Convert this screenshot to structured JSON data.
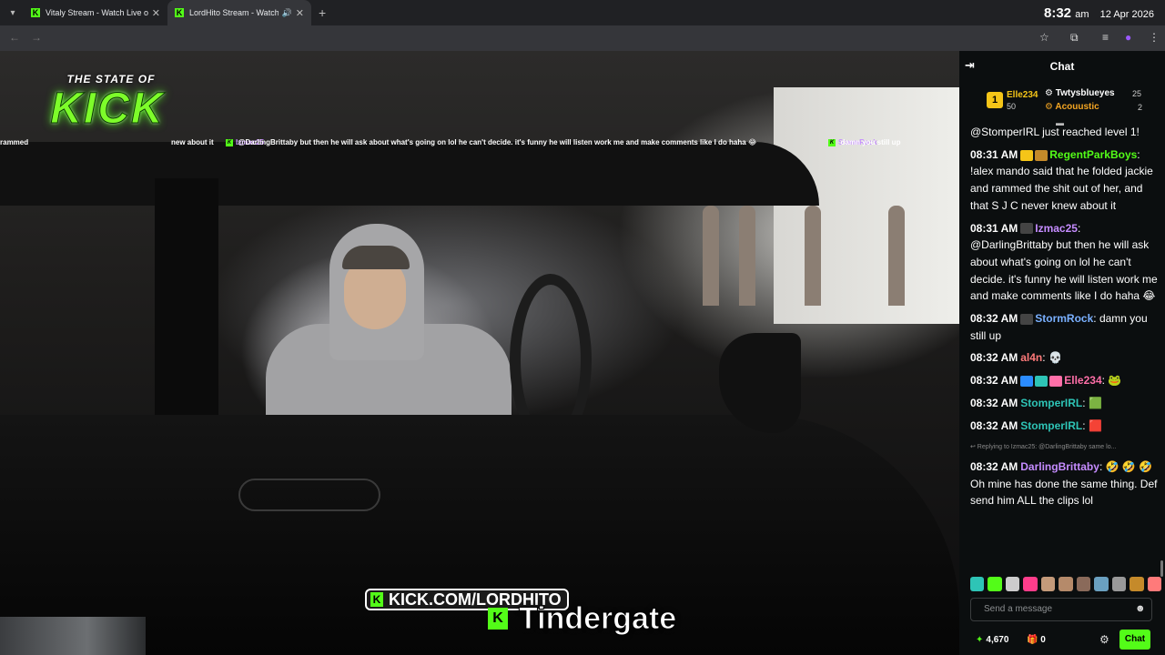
{
  "browser": {
    "tabs": [
      {
        "title": "Vitaly Stream - Watch Live on K",
        "active": false
      },
      {
        "title": "LordHito Stream - Watch Li",
        "active": true
      }
    ],
    "clock_time": "8:32",
    "clock_ampm": "am",
    "clock_date": "12 Apr 2026"
  },
  "overlay": {
    "logo_top": "THE STATE OF",
    "logo_main": "KICK",
    "ticker": [
      {
        "text": "rammed",
        "name": ""
      },
      {
        "text": "new about it",
        "name": ""
      },
      {
        "name": "Izmac25",
        "text": "@DarlingBrittaby but then he will ask about what's going on lol he can't decide. it's funny he will listen work me and make comments like I do haha 😂"
      },
      {
        "name": "StormRock",
        "text": "damn you still up"
      }
    ],
    "kick_url": "KICK.COM/LORDHITO",
    "caption": "Tindergate",
    "k_glyph": "K"
  },
  "chat": {
    "title": "Chat",
    "leaderboard": [
      {
        "rank": "1",
        "name": "Elle234",
        "value": "50",
        "color": "#f5c518"
      },
      {
        "name": "Twtysblueyes",
        "value": "25",
        "color": "#ffffff"
      },
      {
        "name": "Acouustic",
        "value": "2",
        "color": "#f5a623"
      }
    ],
    "messages": [
      {
        "time": "",
        "user": "",
        "color": "#fff",
        "text": "@StomperIRL just reached level 1!"
      },
      {
        "time": "08:31 AM",
        "user": "RegentParkBoys",
        "color": "#53fc18",
        "badges": [
          "#f5c518",
          "#c58a2a"
        ],
        "text": "!alex mando said that he folded jackie and rammed the shit out of her, and that S J C never knew about it"
      },
      {
        "time": "08:31 AM",
        "user": "Izmac25",
        "color": "#c58cff",
        "badges": [
          "#444"
        ],
        "text": "@DarlingBrittaby but then he will ask about what's going on lol he can't decide. it's funny he will listen work me and make comments like I do haha 😂"
      },
      {
        "time": "08:32 AM",
        "user": "StormRock",
        "color": "#7ab0ff",
        "badges": [
          "#444"
        ],
        "text": "damn you still up"
      },
      {
        "time": "08:32 AM",
        "user": "al4n",
        "color": "#ff7a7a",
        "badges": [],
        "text": "💀"
      },
      {
        "time": "08:32 AM",
        "user": "Elle234",
        "color": "#ff6fa8",
        "badges": [
          "#2b8cff",
          "#2ec4b6",
          "#ff6fa8"
        ],
        "text": "🐸"
      },
      {
        "time": "08:32 AM",
        "user": "StomperIRL",
        "color": "#2ec4b6",
        "badges": [],
        "text": "🟩"
      },
      {
        "time": "08:32 AM",
        "user": "StomperIRL",
        "color": "#2ec4b6",
        "badges": [],
        "text": "🟥"
      },
      {
        "reply": "Replying to Izmac25: @DarlingBrittaby same lo...",
        "time": "08:32 AM",
        "user": "DarlingBrittaby",
        "color": "#c58cff",
        "badges": [],
        "text": "🤣 🤣 🤣 Oh mine has done the same thing. Def send him ALL the clips lol"
      }
    ],
    "input_placeholder": "Send a message",
    "points": "4,670",
    "gifts": "0",
    "chat_button": "Chat"
  }
}
